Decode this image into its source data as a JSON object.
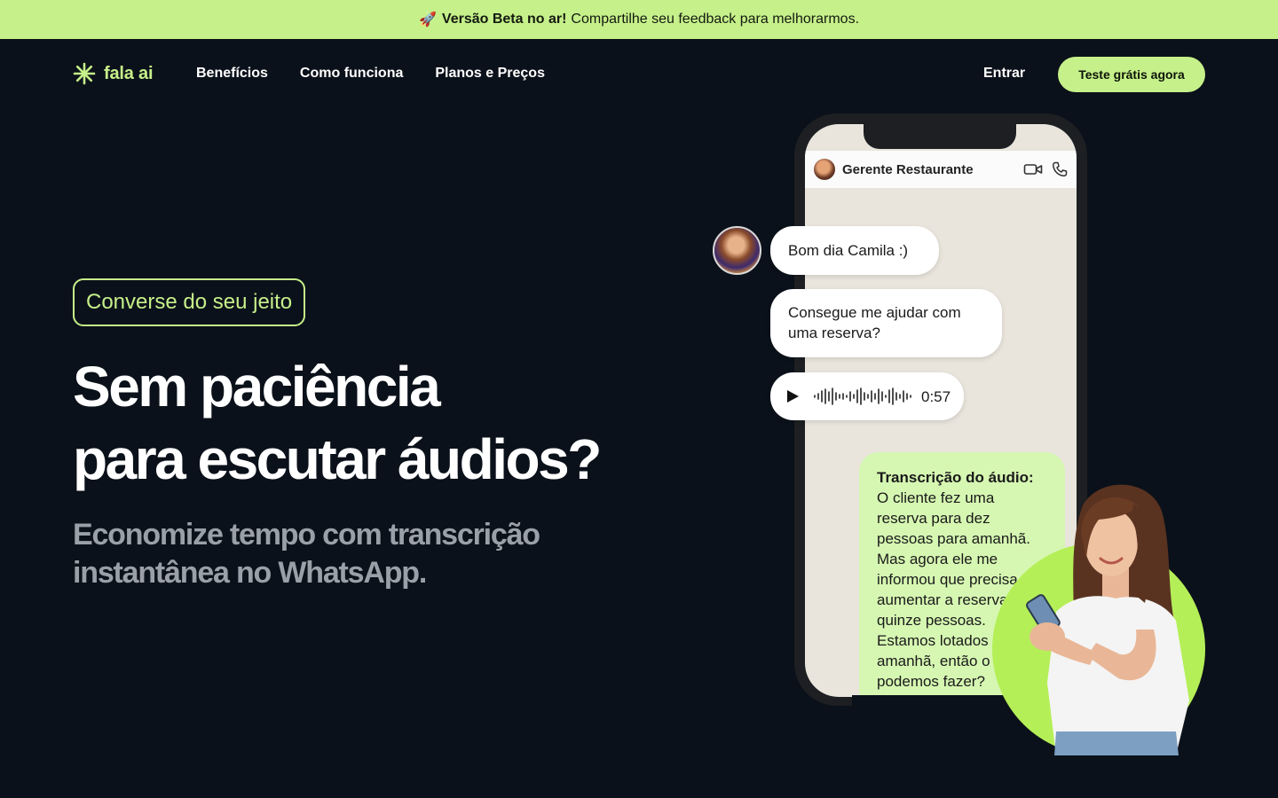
{
  "banner": {
    "emoji": "🚀",
    "strong": "Versão Beta no ar!",
    "text": "Compartilhe seu feedback para melhorarmos."
  },
  "nav": {
    "logo_text": "fala ai",
    "links": [
      "Benefícios",
      "Como funciona",
      "Planos e Preços"
    ],
    "login": "Entrar",
    "cta": "Teste grátis agora"
  },
  "hero": {
    "pill": "Converse do seu jeito",
    "headline_1": "Sem paciência",
    "headline_2": "para escutar áudios?",
    "sub_1": "Economize tempo com transcrição",
    "sub_2": "instantânea no WhatsApp."
  },
  "chat": {
    "contact": "Gerente Restaurante",
    "msg_1": "Bom dia Camila :)",
    "msg_2": "Consegue me ajudar com uma reserva?",
    "audio_duration": "0:57",
    "transcript_title": "Transcrição do áudio:",
    "transcript_text": "O cliente fez uma reserva para dez pessoas para amanhã. Mas agora ele me informou que precisa aumentar a reserva para quinze pessoas. Estamos lotados amanhã, então o que podemos fazer?"
  },
  "colors": {
    "accent": "#c6f08a",
    "background": "#0b111a",
    "circle": "#b5ef58"
  }
}
